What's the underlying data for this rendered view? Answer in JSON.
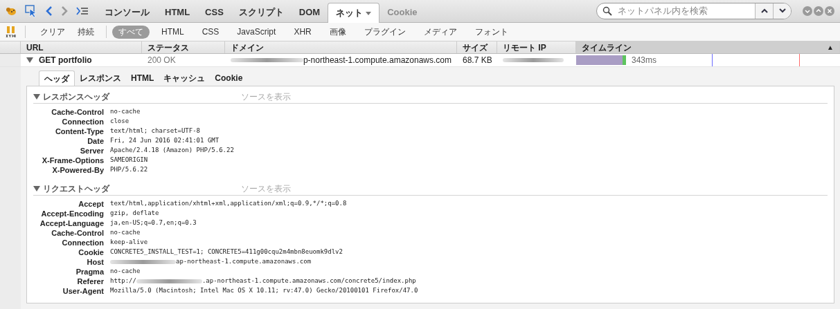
{
  "panel_tabs": [
    {
      "label": "コンソール",
      "selected": false,
      "disabled": false
    },
    {
      "label": "HTML",
      "selected": false,
      "disabled": false
    },
    {
      "label": "CSS",
      "selected": false,
      "disabled": false
    },
    {
      "label": "スクリプト",
      "selected": false,
      "disabled": false
    },
    {
      "label": "DOM",
      "selected": false,
      "disabled": false
    },
    {
      "label": "ネット",
      "selected": true,
      "disabled": false
    },
    {
      "label": "Cookie",
      "selected": false,
      "disabled": true
    }
  ],
  "search": {
    "placeholder": "ネットパネル内を検索"
  },
  "actions": [
    "クリア",
    "持続"
  ],
  "filters": [
    {
      "label": "すべて",
      "selected": true
    },
    {
      "label": "HTML",
      "selected": false
    },
    {
      "label": "CSS",
      "selected": false
    },
    {
      "label": "JavaScript",
      "selected": false
    },
    {
      "label": "XHR",
      "selected": false
    },
    {
      "label": "画像",
      "selected": false
    },
    {
      "label": "プラグイン",
      "selected": false
    },
    {
      "label": "メディア",
      "selected": false
    },
    {
      "label": "フォント",
      "selected": false
    }
  ],
  "columns": [
    {
      "label": "URL",
      "sorted": false
    },
    {
      "label": "ステータス",
      "sorted": false
    },
    {
      "label": "ドメイン",
      "sorted": false
    },
    {
      "label": "サイズ",
      "sorted": false
    },
    {
      "label": "リモート IP",
      "sorted": false
    },
    {
      "label": "タイムライン",
      "sorted": true
    }
  ],
  "sort_arrow": "▲",
  "request": {
    "expanded": true,
    "url": "GET portfolio",
    "status": "200 OK",
    "domain": "p-northeast-1.compute.amazonaws.com",
    "size": "68.7 KB",
    "time": "343ms"
  },
  "detail_tabs": [
    {
      "label": "ヘッダ",
      "selected": true
    },
    {
      "label": "レスポンス",
      "selected": false
    },
    {
      "label": "HTML",
      "selected": false
    },
    {
      "label": "キャッシュ",
      "selected": false
    },
    {
      "label": "Cookie",
      "selected": false
    }
  ],
  "sections": [
    {
      "title": "レスポンスヘッダ",
      "expanded": true,
      "source_link": "ソースを表示",
      "headers": [
        {
          "name": "Cache-Control",
          "value": "no-cache"
        },
        {
          "name": "Connection",
          "value": "close"
        },
        {
          "name": "Content-Type",
          "value": "text/html; charset=UTF-8"
        },
        {
          "name": "Date",
          "value": "Fri, 24 Jun 2016 02:41:01 GMT"
        },
        {
          "name": "Server",
          "value": "Apache/2.4.18 (Amazon) PHP/5.6.22"
        },
        {
          "name": "X-Frame-Options",
          "value": "SAMEORIGIN"
        },
        {
          "name": "X-Powered-By",
          "value": "PHP/5.6.22"
        }
      ]
    },
    {
      "title": "リクエストヘッダ",
      "expanded": true,
      "source_link": "ソースを表示",
      "headers": [
        {
          "name": "Accept",
          "value": "text/html,application/xhtml+xml,application/xml;q=0.9,*/*;q=0.8"
        },
        {
          "name": "Accept-Encoding",
          "value": "gzip, deflate"
        },
        {
          "name": "Accept-Language",
          "value": "ja,en-US;q=0.7,en;q=0.3"
        },
        {
          "name": "Cache-Control",
          "value": "no-cache"
        },
        {
          "name": "Connection",
          "value": "keep-alive"
        },
        {
          "name": "Cookie",
          "value": "CONCRETE5_INSTALL_TEST=1; CONCRETE5=411g00cqu2m4mbn8euomk9dlv2"
        },
        {
          "name": "Host",
          "value": "ap-northeast-1.compute.amazonaws.com",
          "redacted": true
        },
        {
          "name": "Pragma",
          "value": "no-cache"
        },
        {
          "name": "Referer",
          "prefix": "http://",
          "value": ".ap-northeast-1.compute.amazonaws.com/concrete5/index.php",
          "redacted": true
        },
        {
          "name": "User-Agent",
          "value": "Mozilla/5.0 (Macintosh; Intel Mac OS X 10.11; rv:47.0) Gecko/20100101 Firefox/47.0"
        }
      ]
    }
  ]
}
